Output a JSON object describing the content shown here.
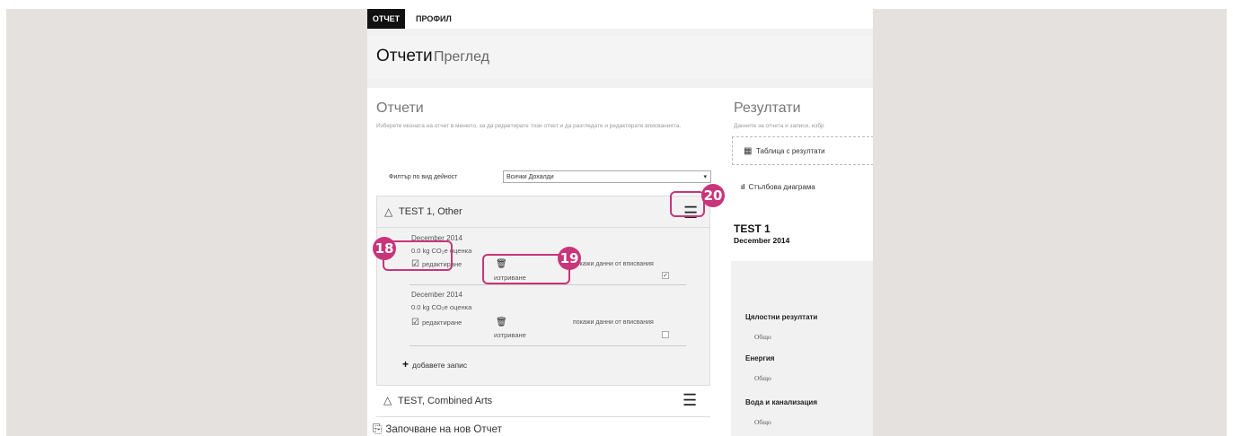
{
  "tabs": [
    {
      "label": "ОТЧЕТ",
      "active": true
    },
    {
      "label": "ПРОФИЛ",
      "active": false
    }
  ],
  "header": {
    "title": "Отчети",
    "subtitle": "Преглед"
  },
  "reports": {
    "heading": "Отчети",
    "description": "Изберете иконата на отчет в менюто, за да редактирате този отчет и да разгледате и редактирате вписванията.",
    "filter": {
      "label": "Филтър по вид дейност",
      "value": "Всички Дохалди"
    },
    "items": [
      {
        "name": "TEST 1, Other",
        "entries": [
          {
            "date": "December 2014",
            "estimate": "0.0 kg CO₂e оценка",
            "edit": "редактиране",
            "delete": "изтриване",
            "show_data": "покажи данни от вписвания",
            "show_data_checked": true
          },
          {
            "date": "December 2014",
            "estimate": "0.0 kg CO₂e оценка",
            "edit": "редактиране",
            "delete": "изтриване",
            "show_data": "покажи данни от вписвания",
            "show_data_checked": false
          }
        ],
        "add_entry": "добавете запис"
      },
      {
        "name": "TEST, Combined Arts"
      }
    ],
    "new_report": "Започване на нов Отчет"
  },
  "results": {
    "heading": "Резултати",
    "description": "Данните за отчета и записи, избр",
    "table_button": "Таблица с резултати",
    "bar_chart": "Стълбова диаграма",
    "report_title": "TEST 1",
    "report_date": "December 2014",
    "categories": [
      {
        "name": "Цялостни резултати",
        "sub": "Общо"
      },
      {
        "name": "Енергия",
        "sub": "Общо"
      },
      {
        "name": "Вода и канализация",
        "sub": "Общо"
      }
    ]
  },
  "callouts": [
    "18",
    "19",
    "20"
  ],
  "colors": {
    "callout": "#c8357a",
    "side_background": "#e5e1de",
    "active_tab": "#111111"
  },
  "icons": {
    "menu": "hamburger-icon",
    "triangle": "warning-triangle-icon",
    "edit": "edit-icon",
    "delete": "trash-icon",
    "add": "plus-icon",
    "table": "table-icon",
    "bar_chart": "bar-chart-icon",
    "new_report": "new-report-icon"
  }
}
